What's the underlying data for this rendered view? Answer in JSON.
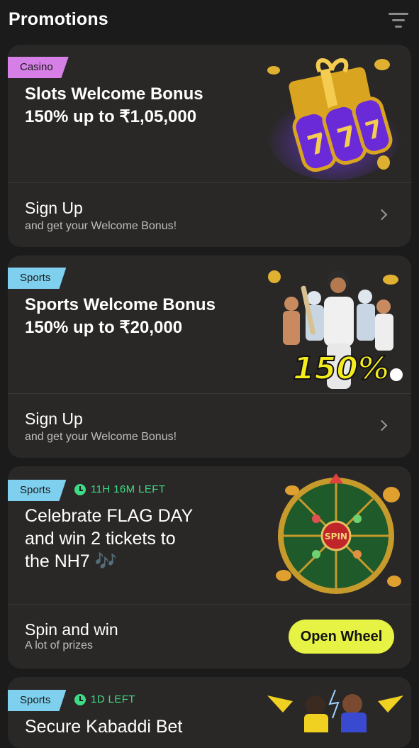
{
  "header": {
    "title": "Promotions",
    "filter_icon": "filter-icon"
  },
  "promotions": [
    {
      "tag": "Casino",
      "title_line1": "Slots Welcome Bonus",
      "title_line2": "150% up to ₹1,05,000",
      "cta_title": "Sign Up",
      "cta_subtitle": "and get your Welcome Bonus!",
      "image": "slot-reels-gift-icon"
    },
    {
      "tag": "Sports",
      "title_line1": "Sports Welcome Bonus",
      "title_line2": "150% up to ₹20,000",
      "cta_title": "Sign Up",
      "cta_subtitle": "and get your Welcome Bonus!",
      "image_text": "150%",
      "image": "athletes-group-icon"
    },
    {
      "tag": "Sports",
      "timer": "11H 16M LEFT",
      "title_line1": "Celebrate FLAG DAY",
      "title_line2": "and win 2 tickets to",
      "title_line3": "the NH7 🎶",
      "cta_title": "Spin and win",
      "cta_subtitle": "A lot of prizes",
      "button": "Open Wheel",
      "image_text": "SPIN",
      "image": "prize-wheel-icon"
    },
    {
      "tag": "Sports",
      "timer": "1D LEFT",
      "title_line1": "Secure Kabaddi Bet",
      "image": "kabaddi-players-icon"
    }
  ],
  "colors": {
    "background": "#1b1b1b",
    "card": "#2a2827",
    "casino_tag": "#d67fe6",
    "sports_tag": "#7fcfee",
    "timer": "#3ddc84",
    "accent_button": "#e6f345"
  }
}
